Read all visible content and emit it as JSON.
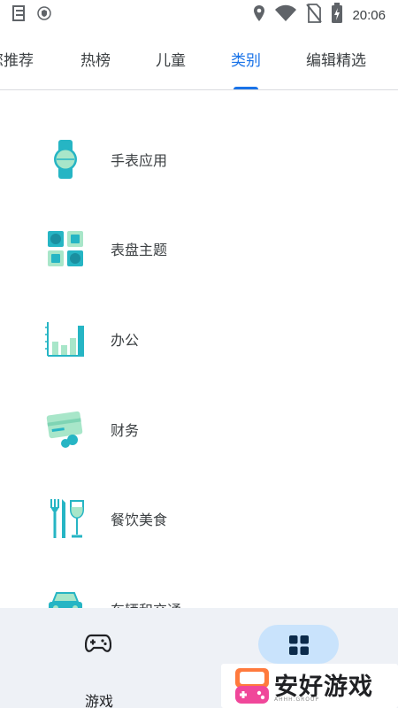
{
  "status_bar": {
    "time": "20:06",
    "icons": [
      "notes-icon",
      "shield-icon",
      "location-icon",
      "wifi-icon",
      "no-sim-icon",
      "battery-charging-icon"
    ]
  },
  "tabs": [
    {
      "label": "您推荐",
      "active": false
    },
    {
      "label": "热榜",
      "active": false
    },
    {
      "label": "儿童",
      "active": false
    },
    {
      "label": "类别",
      "active": true
    },
    {
      "label": "编辑精选",
      "active": false
    }
  ],
  "categories": [
    {
      "label": "手表应用",
      "icon": "watch-icon"
    },
    {
      "label": "表盘主题",
      "icon": "watch-faces-icon"
    },
    {
      "label": "办公",
      "icon": "office-chart-icon"
    },
    {
      "label": "财务",
      "icon": "finance-card-icon"
    },
    {
      "label": "餐饮美食",
      "icon": "food-drink-icon"
    },
    {
      "label": "车辆和交通",
      "icon": "vehicle-icon"
    }
  ],
  "bottom_nav": {
    "games_label": "游戏",
    "games_icon": "gamepad-icon",
    "apps_icon": "apps-grid-icon"
  },
  "watermark": {
    "text": "安好游戏",
    "sub": "AHHH.GROUP"
  },
  "colors": {
    "accent": "#1a73e8",
    "icon_teal": "#26b5c4",
    "icon_mint": "#a8e6c9",
    "nav_background": "#eef1f6",
    "nav_active_pill": "#c9e3fc"
  }
}
